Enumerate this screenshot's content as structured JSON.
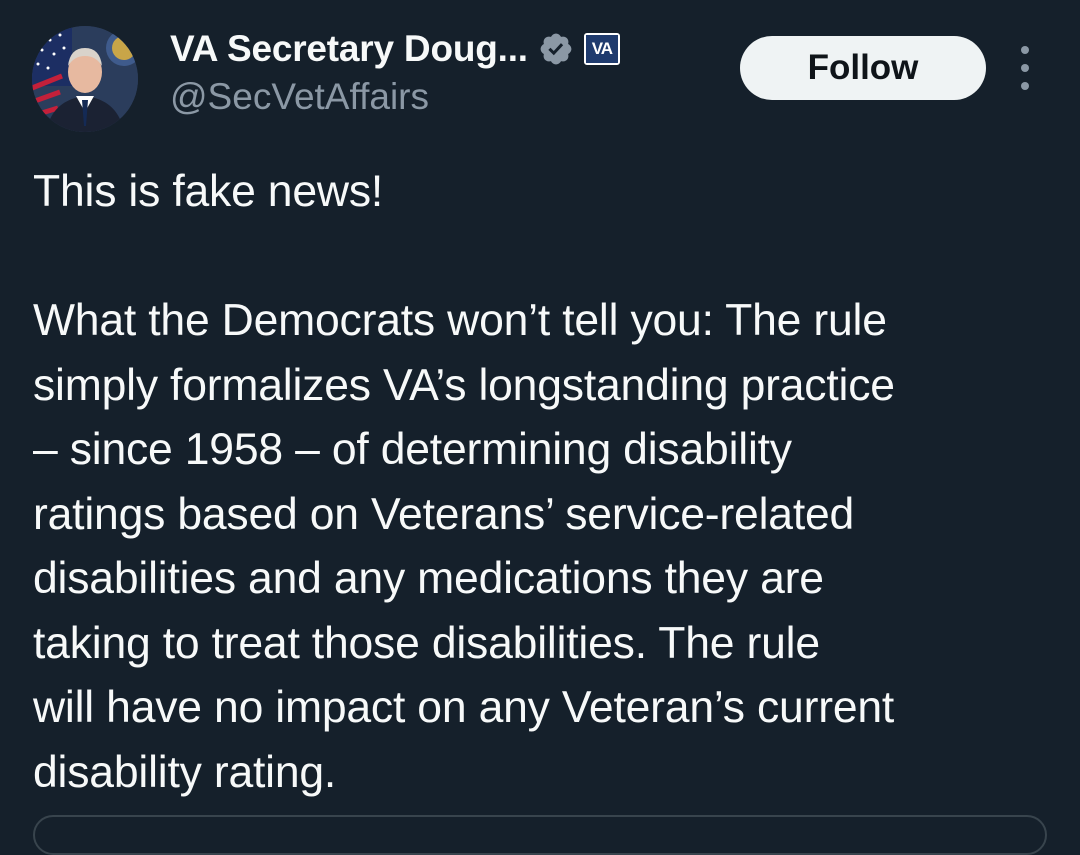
{
  "author": {
    "display_name": "VA Secretary Doug...",
    "handle": "@SecVetAffairs",
    "affiliation_badge_text": "VA"
  },
  "actions": {
    "follow_label": "Follow"
  },
  "tweet": {
    "line_01": "This is fake news!",
    "line_02": "What the Democrats won’t tell you: The rule",
    "line_03": "simply formalizes VA’s longstanding practice",
    "line_04": "– since 1958 – of determining disability",
    "line_05": "ratings based on Veterans’ service-related",
    "line_06": "disabilities and any medications they are",
    "line_07": "taking to treat those disabilities. The rule",
    "line_08": "will have no impact on any Veteran’s current",
    "line_09": "disability rating."
  },
  "colors": {
    "background": "#15202b",
    "text_primary": "#f7f9f9",
    "text_secondary": "#8b98a5",
    "button_bg": "#eff3f4",
    "badge_blue": "#1f3b6e"
  },
  "icons": {
    "verified": "verified-badge-icon",
    "more": "more-options-icon"
  }
}
